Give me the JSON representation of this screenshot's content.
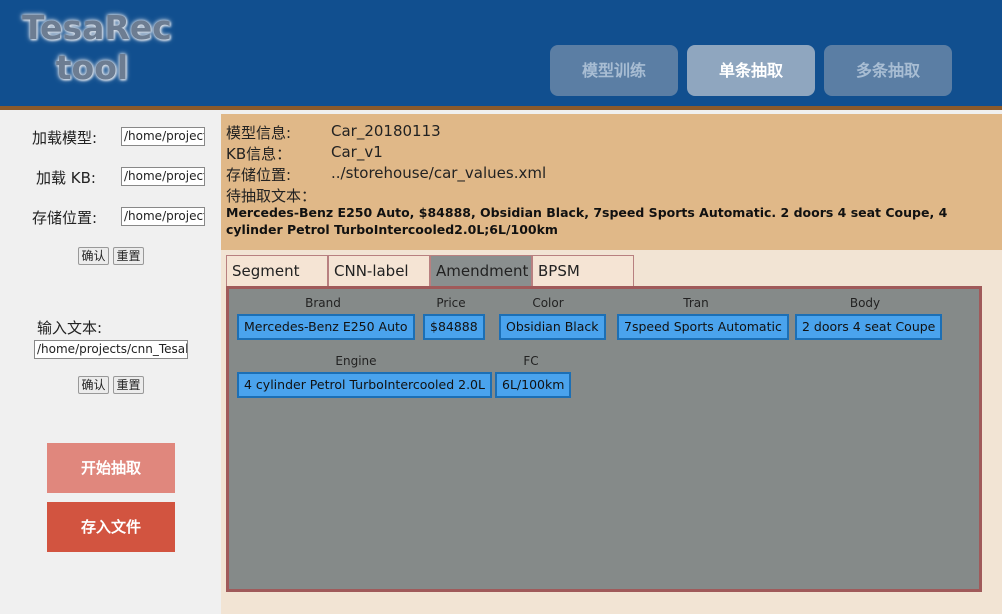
{
  "header": {
    "logo_line1": "TesaRec",
    "logo_line2": "tool",
    "nav": [
      "模型训练",
      "单条抽取",
      "多条抽取"
    ]
  },
  "left": {
    "load_model_label": "加载模型:",
    "load_model_value": "/home/project",
    "load_kb_label": "加载 KB:",
    "load_kb_value": "/home/project",
    "save_loc_label": "存储位置:",
    "save_loc_value": "/home/project",
    "confirm_label": "确认",
    "reset_label": "重置",
    "input_text_label": "输入文本:",
    "input_text_value": "/home/projects/cnn_Tesal",
    "start_extract_label": "开始抽取",
    "save_file_label": "存入文件"
  },
  "info": {
    "model_label": "模型信息:",
    "model_value": "Car_20180113",
    "kb_label": "KB信息：",
    "kb_value": "Car_v1",
    "store_label": "存储位置:",
    "store_value": "../storehouse/car_values.xml",
    "text_label": "待抽取文本：",
    "text_value": "Mercedes-Benz E250 Auto, $84888, Obsidian Black, 7speed Sports Automatic. 2 doors 4 seat Coupe, 4 cylinder Petrol TurboIntercooled2.0L;6L/100km"
  },
  "tabs": [
    "Segment",
    "CNN-label",
    "Amendment",
    "BPSM"
  ],
  "active_tab": "Amendment",
  "fields": [
    {
      "name": "Brand",
      "value": "Mercedes-Benz E250 Auto"
    },
    {
      "name": "Price",
      "value": "$84888"
    },
    {
      "name": "Color",
      "value": "Obsidian Black"
    },
    {
      "name": "Tran",
      "value": "7speed Sports Automatic"
    },
    {
      "name": "Body",
      "value": "2 doors 4 seat Coupe"
    },
    {
      "name": "Engine",
      "value": "4 cylinder Petrol TurboIntercooled 2.0L"
    },
    {
      "name": "FC",
      "value": "6L/100km"
    }
  ],
  "colors": {
    "header_bg": "#114f8f",
    "info_bg": "#e0b888",
    "chip_bg": "#4aa3ed",
    "start_btn": "#e0877d",
    "save_btn": "#d25440"
  }
}
